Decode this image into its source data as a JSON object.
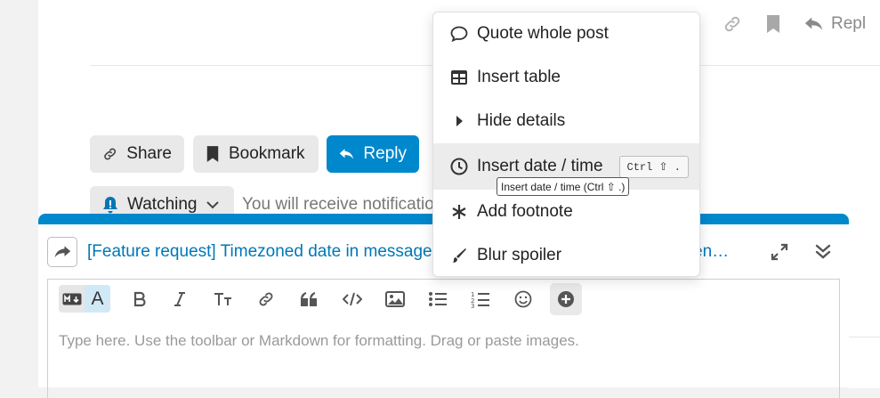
{
  "top_actions": {
    "reply_label": "Repl"
  },
  "post_buttons": {
    "share": "Share",
    "bookmark": "Bookmark",
    "reply": "Reply"
  },
  "notifications": {
    "level": "Watching",
    "description": "You will receive notificatio"
  },
  "composer": {
    "title_start": "[Feature request] Timezoned date in message",
    "title_end": "en…",
    "placeholder": "Type here. Use the toolbar or Markdown for formatting. Drag or paste images.",
    "mode_rich_label": "A"
  },
  "menu": {
    "items": [
      {
        "label": "Quote whole post",
        "icon": "speech-bubble-icon"
      },
      {
        "label": "Insert table",
        "icon": "table-icon"
      },
      {
        "label": "Hide details",
        "icon": "caret-right-icon"
      },
      {
        "label": "Insert date / time",
        "icon": "clock-icon",
        "shortcut": "Ctrl ⇧ .",
        "highlighted": true
      },
      {
        "label": "Add footnote",
        "icon": "asterisk-icon"
      },
      {
        "label": "Blur spoiler",
        "icon": "paintbrush-icon"
      }
    ],
    "tooltip": "Insert date / time (Ctrl ⇧ .)"
  },
  "colors": {
    "accent": "#0088cc",
    "link": "#0077b6",
    "button_bg": "#e9e9e9"
  }
}
